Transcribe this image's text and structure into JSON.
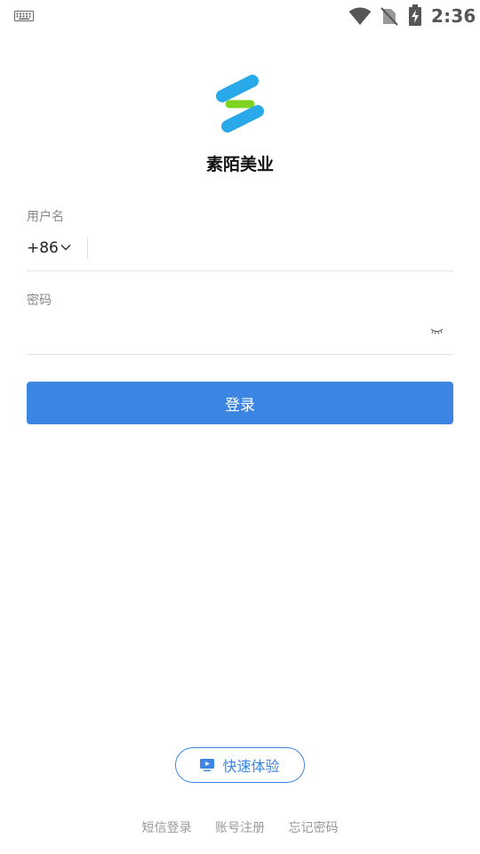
{
  "status_bar": {
    "time": "2:36",
    "icons": [
      "keyboard-icon",
      "wifi-icon",
      "no-sim-icon",
      "battery-charging-icon"
    ]
  },
  "app": {
    "name": "素陌美业",
    "logo": "app-logo",
    "colors": {
      "logo_blue": "#29a8ea",
      "logo_green": "#7ed321"
    }
  },
  "login": {
    "username_label": "用户名",
    "country_code": "+86",
    "username_value": "",
    "password_label": "密码",
    "password_value": "",
    "submit_label": "登录"
  },
  "quick_experience": {
    "label": "快速体验",
    "icon": "tv-play-icon"
  },
  "footer": {
    "links": [
      "短信登录",
      "账号注册",
      "忘记密码"
    ]
  },
  "colors": {
    "primary": "#3d85e3",
    "divider": "#e3e3e3",
    "muted_text": "#999999"
  }
}
